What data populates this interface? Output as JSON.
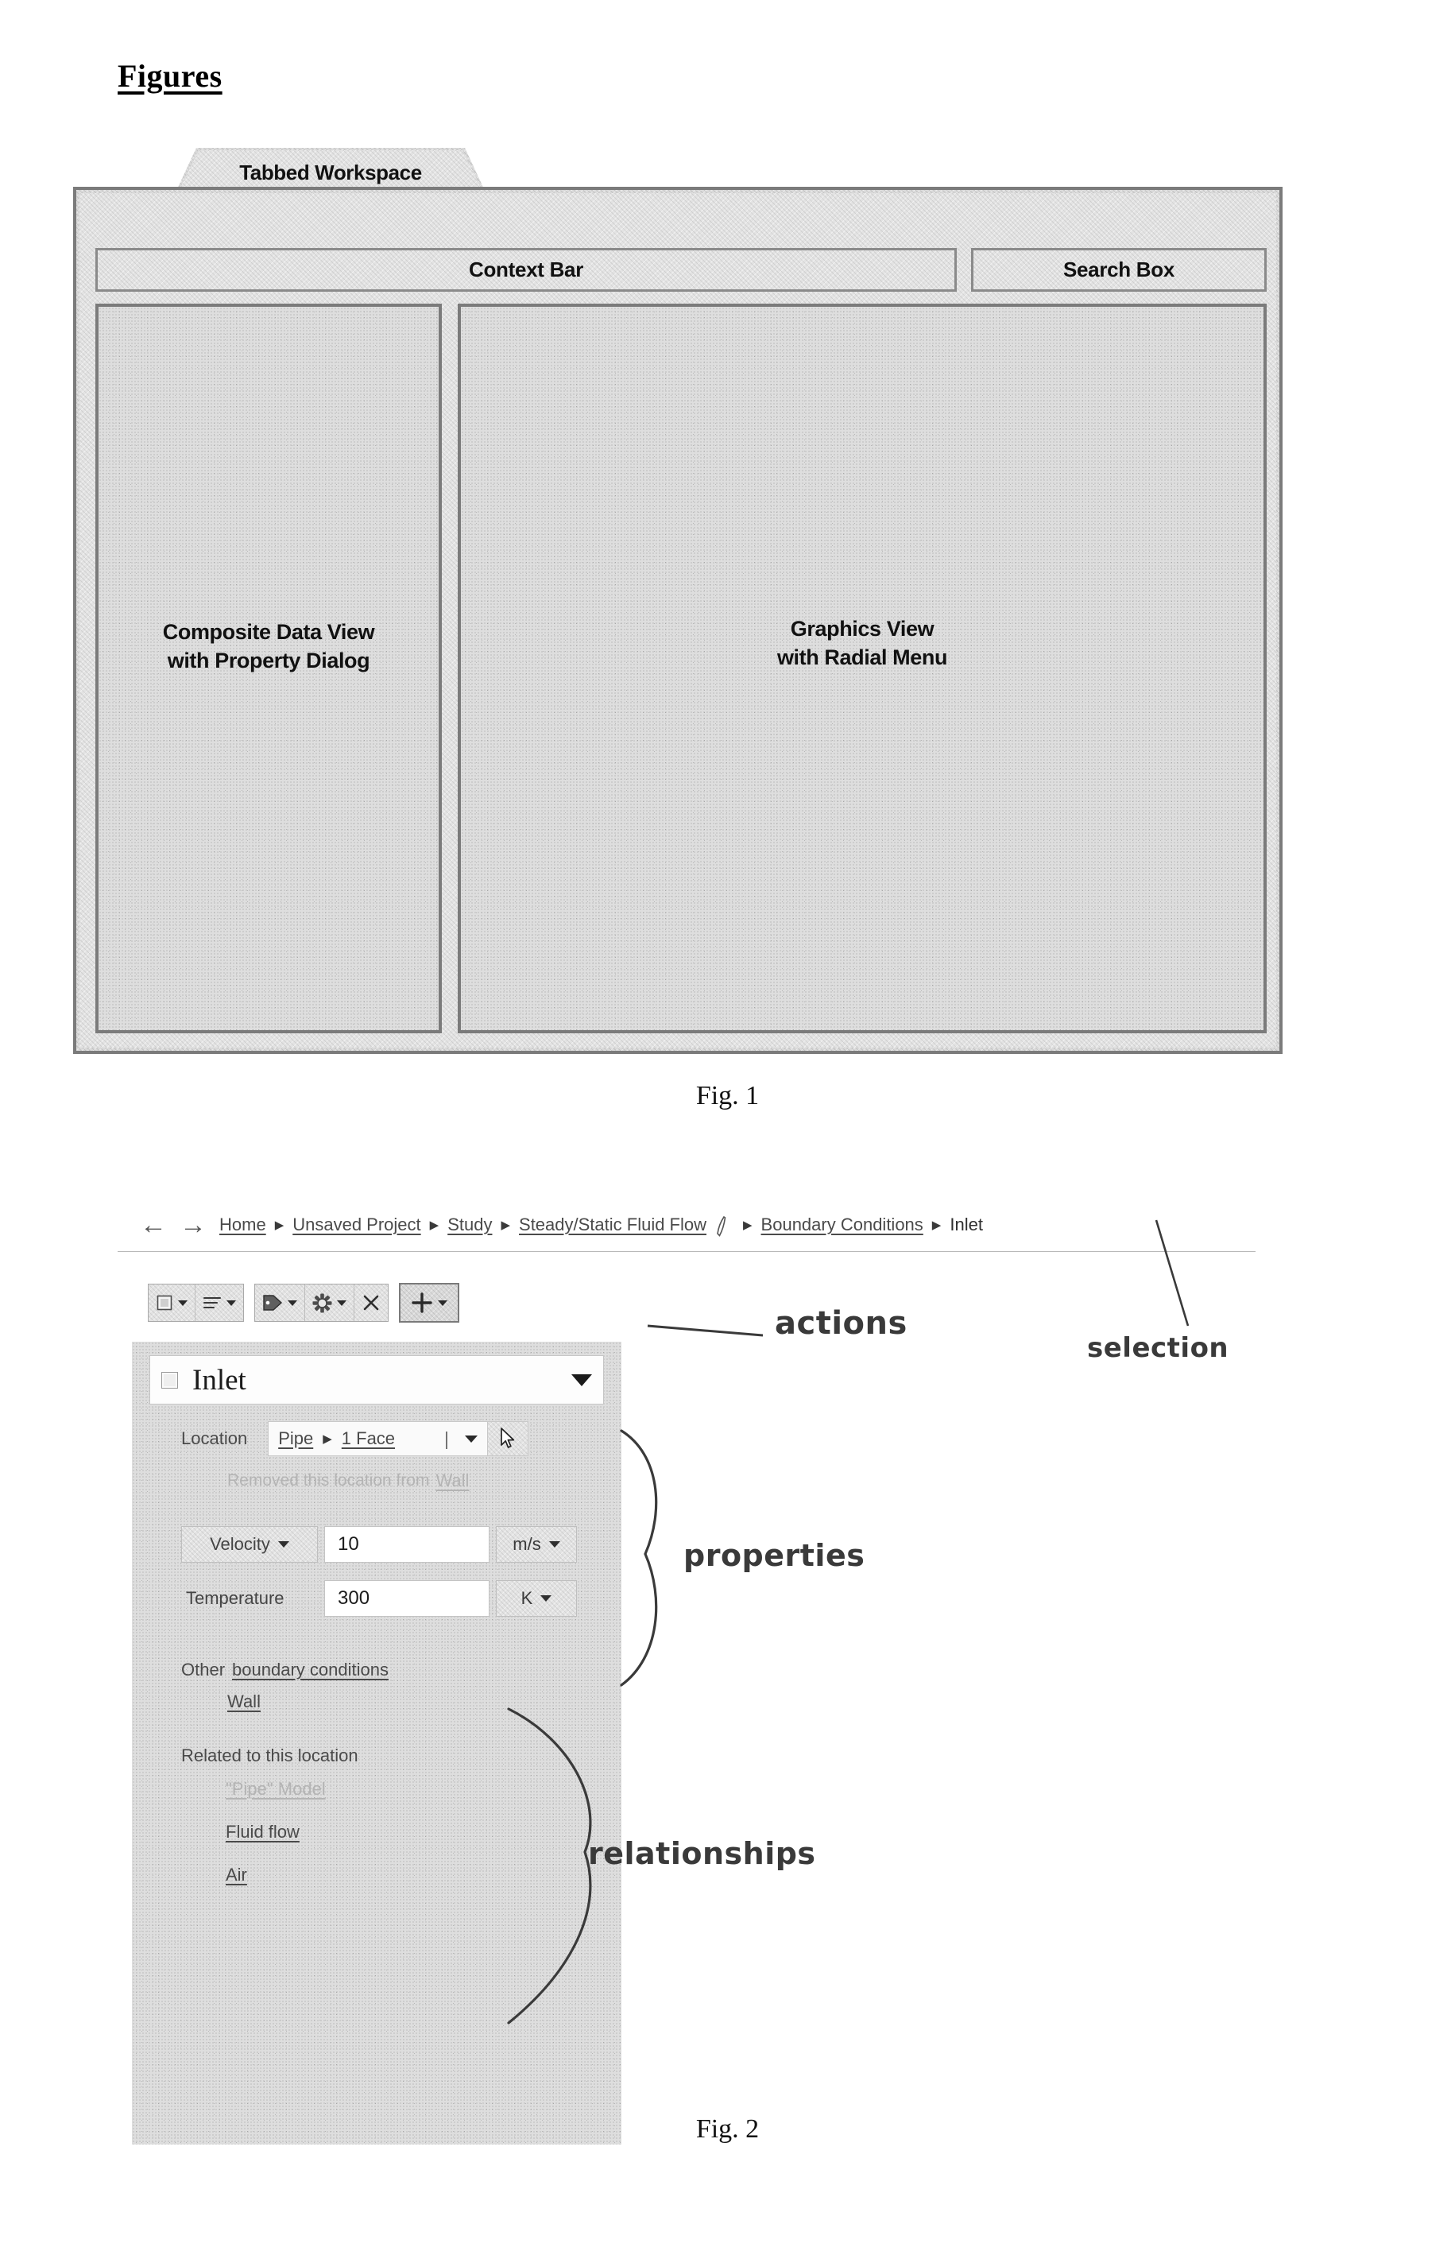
{
  "heading": "Figures",
  "fig1": {
    "caption": "Fig. 1",
    "tab_label": "Tabbed Workspace",
    "context_bar_label": "Context Bar",
    "search_box_label": "Search Box",
    "left_panel_label": "Composite Data View\nwith Property Dialog",
    "right_panel_label": "Graphics View\nwith Radial Menu"
  },
  "fig2": {
    "caption": "Fig. 2",
    "nav": {
      "back_icon": "arrow-left-icon",
      "forward_icon": "arrow-right-icon"
    },
    "breadcrumb": [
      {
        "label": "Home",
        "current": false
      },
      {
        "label": "Unsaved Project",
        "current": false
      },
      {
        "label": "Study",
        "current": false
      },
      {
        "label": "Steady/Static Fluid Flow",
        "current": false,
        "icon": "pencil-icon"
      },
      {
        "label": "Boundary Conditions",
        "current": false
      },
      {
        "label": "Inlet",
        "current": true
      }
    ],
    "breadcrumb_separator": "▶",
    "toolbar": {
      "groups": [
        {
          "buttons": [
            {
              "icon": "checkbox-icon",
              "caret": true
            },
            {
              "icon": "list-icon",
              "caret": true
            }
          ]
        },
        {
          "buttons": [
            {
              "icon": "tag-icon",
              "caret": true
            },
            {
              "icon": "gear-icon",
              "caret": true
            },
            {
              "icon": "close-x-icon",
              "caret": false
            }
          ]
        },
        {
          "primary": true,
          "buttons": [
            {
              "icon": "plus-icon",
              "caret": true
            }
          ]
        }
      ]
    },
    "dialog": {
      "title": "Inlet",
      "title_checkbox_icon": "checkbox-icon",
      "title_caret_icon": "chevron-down-icon",
      "location": {
        "label": "Location",
        "path": [
          "Pipe",
          "1 Face"
        ],
        "path_separator": "▶",
        "text_cursor": "|",
        "caret_icon": "chevron-down-icon",
        "pointer_icon": "mouse-pointer-icon"
      },
      "removed_note": "Removed this location from",
      "removed_note_link": "Wall",
      "properties": [
        {
          "name": "Velocity",
          "name_is_button": true,
          "value": "10",
          "unit": "m/s"
        },
        {
          "name": "Temperature",
          "name_is_button": false,
          "value": "300",
          "unit": "K"
        }
      ],
      "other_label": "Other",
      "other_link": "boundary conditions",
      "other_items": [
        "Wall"
      ],
      "related_label": "Related to this location",
      "related_items": [
        "\"Pipe\" Model",
        "Fluid flow",
        "Air"
      ]
    },
    "annotations": {
      "actions": "actions",
      "selection": "selection",
      "properties": "properties",
      "relationships": "relationships"
    }
  }
}
